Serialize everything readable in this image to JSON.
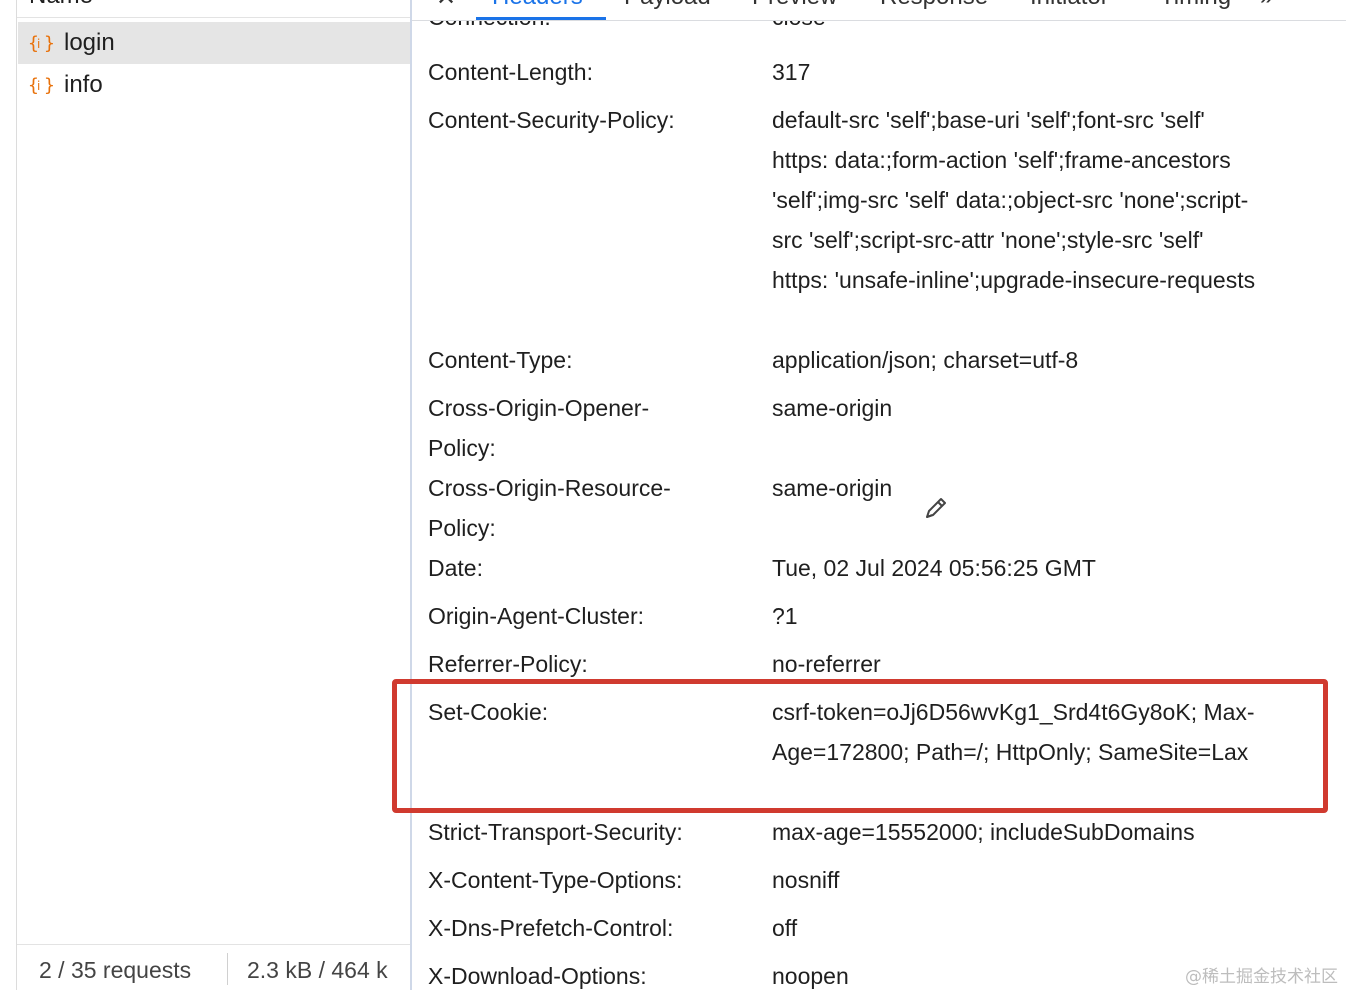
{
  "left_panel": {
    "column_header": "Name",
    "requests": [
      {
        "name": "login",
        "icon": "json-braces-icon",
        "selected": true
      },
      {
        "name": "info",
        "icon": "json-braces-icon",
        "selected": false
      }
    ],
    "footer": {
      "requests_count": "2 / 35 requests",
      "transfer_size": "2.3 kB / 464 k"
    }
  },
  "tabs": {
    "close_glyph": "✕",
    "items": [
      "Headers",
      "Payload",
      "Preview",
      "Response",
      "Initiator",
      "Timing"
    ],
    "active": "Headers",
    "more_glyph": "»"
  },
  "headers": [
    {
      "name": "Connection:",
      "value": "close"
    },
    {
      "name": "Content-Length:",
      "value": "317"
    },
    {
      "name": "Content-Security-Policy:",
      "value": "default-src 'self';base-uri 'self';font-src 'self' https: data:;form-action 'self';frame-ancestors 'self';img-src 'self' data:;object-src 'none';script-src 'self';script-src-attr 'none';style-src 'self' https: 'unsafe-inline';upgrade-insecure-requests"
    },
    {
      "name": "Content-Type:",
      "value": "application/json; charset=utf-8"
    },
    {
      "name": "Cross-Origin-Opener-Policy:",
      "value": "same-origin"
    },
    {
      "name": "Cross-Origin-Resource-Policy:",
      "value": "same-origin"
    },
    {
      "name": "Date:",
      "value": "Tue, 02 Jul 2024 05:56:25 GMT"
    },
    {
      "name": "Origin-Agent-Cluster:",
      "value": "?1"
    },
    {
      "name": "Referrer-Policy:",
      "value": "no-referrer"
    },
    {
      "name": "Set-Cookie:",
      "value": "csrf-token=oJj6D56wvKg1_Srd4t6Gy8oK; Max-Age=172800; Path=/; HttpOnly; SameSite=Lax"
    },
    {
      "name": "Strict-Transport-Security:",
      "value": "max-age=15552000; includeSubDomains"
    },
    {
      "name": "X-Content-Type-Options:",
      "value": "nosniff"
    },
    {
      "name": "X-Dns-Prefetch-Control:",
      "value": "off"
    },
    {
      "name": "X-Download-Options:",
      "value": "noopen"
    }
  ],
  "watermark": "@稀土掘金技术社区",
  "colors": {
    "accent": "#1a73e8",
    "highlight": "#d03a2f",
    "json_icon": "#e8710a"
  }
}
